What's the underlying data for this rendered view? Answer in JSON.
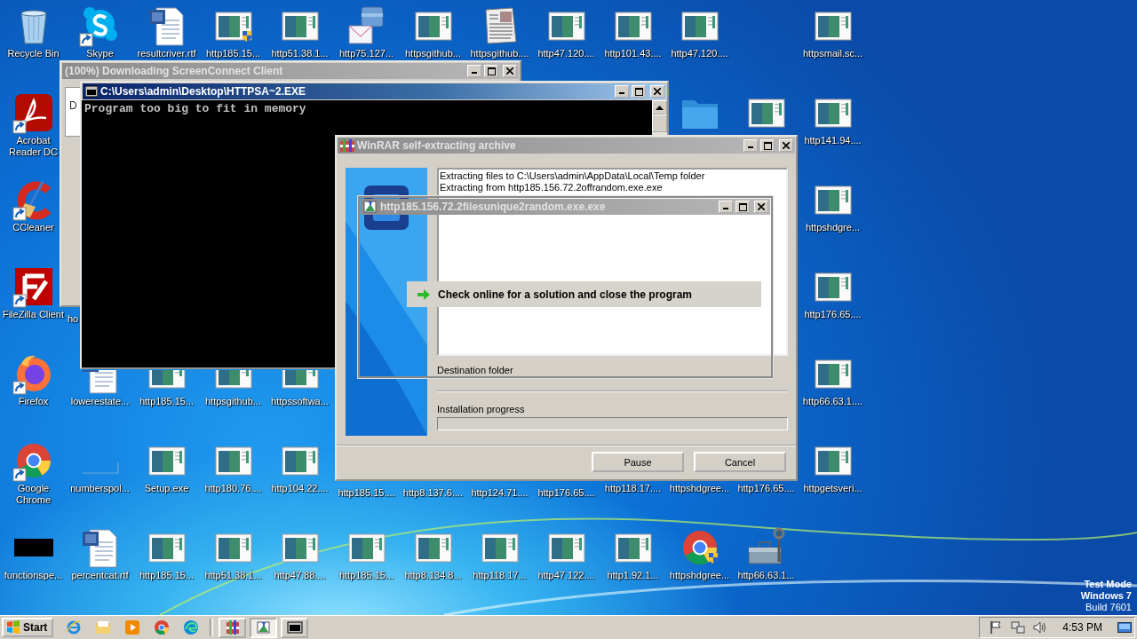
{
  "desktop": {
    "icons": [
      {
        "label": "Recycle Bin",
        "kind": "recycle",
        "shortcut": false
      },
      {
        "label": "Skype",
        "kind": "chat",
        "shortcut": true
      },
      {
        "label": "resultcriver.rtf",
        "kind": "word",
        "shortcut": false
      },
      {
        "label": "http185.15...",
        "kind": "app-shield",
        "shortcut": false
      },
      {
        "label": "http51.38.1...",
        "kind": "app",
        "shortcut": false
      },
      {
        "label": "http75.127...",
        "kind": "mail",
        "shortcut": false
      },
      {
        "label": "httpsgithub...",
        "kind": "app",
        "shortcut": false
      },
      {
        "label": "httpsgithub....",
        "kind": "newspaper",
        "shortcut": false
      },
      {
        "label": "http47.120....",
        "kind": "app",
        "shortcut": false
      },
      {
        "label": "http101.43....",
        "kind": "app",
        "shortcut": false
      },
      {
        "label": "http47.120....",
        "kind": "app",
        "shortcut": false
      },
      {
        "label": "httpsmail.sc...",
        "kind": "app",
        "shortcut": false
      },
      {
        "label": "Acrobat Reader DC",
        "kind": "pdf",
        "shortcut": true
      },
      {
        "kind": "folder",
        "shortcut": false
      },
      {
        "kind": "app",
        "shortcut": false
      },
      {
        "label": "http141.94....",
        "kind": "app",
        "shortcut": false
      },
      {
        "label": "CCleaner",
        "kind": "broom",
        "shortcut": true
      },
      {
        "label": "httpshdgre...",
        "kind": "app",
        "shortcut": false
      },
      {
        "label": "FileZilla Client",
        "kind": "ftp",
        "shortcut": true
      },
      {
        "label": "ho",
        "kind": "none"
      },
      {
        "label": "http176.65....",
        "kind": "app",
        "shortcut": false
      },
      {
        "label": "Firefox",
        "kind": "firefox",
        "shortcut": true
      },
      {
        "label": "lowerestate...",
        "kind": "word",
        "shortcut": false
      },
      {
        "label": "http185.15...",
        "kind": "app",
        "shortcut": false
      },
      {
        "label": "httpsgithub...",
        "kind": "app",
        "shortcut": false
      },
      {
        "label": "httpssoftwa...",
        "kind": "app",
        "shortcut": false
      },
      {
        "label": "http66.63.1....",
        "kind": "app",
        "shortcut": false
      },
      {
        "label": "Google Chrome",
        "kind": "chrome",
        "shortcut": true
      },
      {
        "label": "numberspol...",
        "kind": "blank",
        "shortcut": false
      },
      {
        "label": "Setup.exe",
        "kind": "app",
        "shortcut": false
      },
      {
        "label": "http180.76....",
        "kind": "app",
        "shortcut": false
      },
      {
        "label": "http104.22....",
        "kind": "app",
        "shortcut": false
      },
      {
        "label": "http185.15....",
        "kind": "none"
      },
      {
        "label": "http8.137.6....",
        "kind": "none"
      },
      {
        "label": "http124.71....",
        "kind": "none"
      },
      {
        "label": "http176.65....",
        "kind": "none"
      },
      {
        "label": "http118.17....",
        "kind": "app",
        "shortcut": false
      },
      {
        "label": "httpshdgree...",
        "kind": "app",
        "shortcut": false
      },
      {
        "label": "http176.65....",
        "kind": "app",
        "shortcut": false
      },
      {
        "label": "httpgetsveri...",
        "kind": "app",
        "shortcut": false
      },
      {
        "label": "functionspe...",
        "kind": "black",
        "shortcut": false
      },
      {
        "label": "percentcat.rtf",
        "kind": "word",
        "shortcut": false
      },
      {
        "label": "http185.15...",
        "kind": "app",
        "shortcut": false
      },
      {
        "label": "http51.38.1...",
        "kind": "app",
        "shortcut": false
      },
      {
        "label": "http47.88....",
        "kind": "app",
        "shortcut": false
      },
      {
        "label": "http185.15...",
        "kind": "app",
        "shortcut": false
      },
      {
        "label": "http8.134.8...",
        "kind": "app",
        "shortcut": false
      },
      {
        "label": "http118.17...",
        "kind": "app",
        "shortcut": false
      },
      {
        "label": "http47.122....",
        "kind": "app",
        "shortcut": false
      },
      {
        "label": "http1.92.1...",
        "kind": "app",
        "shortcut": false
      },
      {
        "label": "httpshdgree...",
        "kind": "chrome-shield",
        "shortcut": false
      },
      {
        "label": "http66.63.1...",
        "kind": "toolbox",
        "shortcut": false
      }
    ]
  },
  "windows": [
    {
      "kind": "screenconnect",
      "title": "(100%) Downloading ScreenConnect Client",
      "active": false,
      "text": "D"
    },
    {
      "kind": "console",
      "title": "C:\\Users\\admin\\Desktop\\HTTPSA~2.EXE",
      "active": true,
      "lines": [
        "Program too big to fit in memory"
      ]
    },
    {
      "kind": "winrar",
      "title": "WinRAR self-extracting archive",
      "active": false,
      "log": [
        "Extracting files to C:\\Users\\admin\\AppData\\Local\\Temp folder",
        "Extracting from http185.156.72.2offrandom.exe.exe"
      ],
      "destination_label": "Destination folder",
      "progress_label": "Installation progress",
      "progress": {
        "level": 0
      },
      "buttons": [
        "Pause",
        "Cancel"
      ]
    },
    {
      "kind": "popup",
      "title": "http185.156.72.2filesunique2random.exe.exe",
      "active": false,
      "option": "Check online for a solution and close the program"
    }
  ],
  "system_text": [
    "Test Mode",
    "Windows 7",
    "Build 7601"
  ],
  "taskbar": {
    "start": "Start",
    "pinned": [
      {
        "kind": "ie"
      },
      {
        "kind": "explorer"
      },
      {
        "kind": "media"
      },
      {
        "kind": "chrome"
      },
      {
        "kind": "edge"
      }
    ],
    "tasks": [
      {
        "kind": "archive",
        "selected": false
      },
      {
        "kind": "setup",
        "selected": true
      },
      {
        "kind": "console",
        "selected": false
      }
    ],
    "clock": "4:53 PM"
  }
}
